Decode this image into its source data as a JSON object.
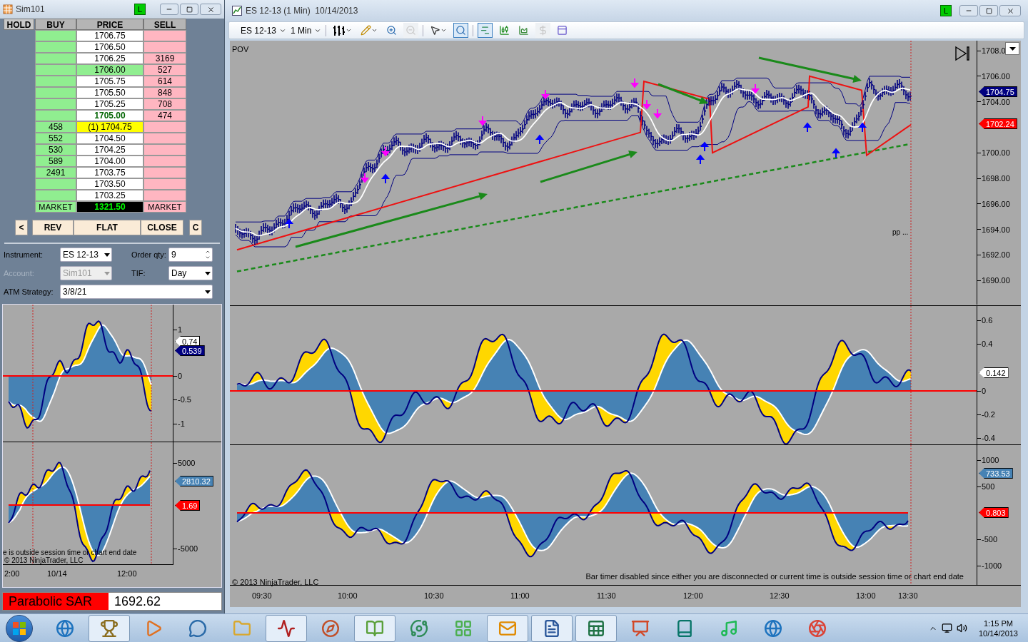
{
  "dom_window": {
    "title": "Sim101",
    "badge": "L",
    "columns": [
      "HOLD",
      "BUY",
      "PRICE",
      "SELL"
    ],
    "rows": [
      {
        "price": "1706.75",
        "kind": "plain"
      },
      {
        "price": "1706.50",
        "kind": "plain"
      },
      {
        "price": "1706.25",
        "sell": "3169",
        "kind": "plain"
      },
      {
        "price": "1706.00",
        "sell": "527",
        "kind": "inside"
      },
      {
        "price": "1705.75",
        "sell": "614",
        "kind": "plain"
      },
      {
        "price": "1705.50",
        "sell": "848",
        "kind": "plain"
      },
      {
        "price": "1705.25",
        "sell": "708",
        "kind": "plain"
      },
      {
        "price": "1705.00",
        "sell": "474",
        "kind": "last"
      },
      {
        "buy": "458",
        "price": "(1) 1704.75",
        "kind": "position"
      },
      {
        "buy": "552",
        "price": "1704.50",
        "kind": "plain"
      },
      {
        "buy": "530",
        "price": "1704.25",
        "kind": "plain"
      },
      {
        "buy": "589",
        "price": "1704.00",
        "kind": "plain"
      },
      {
        "buy": "2491",
        "price": "1703.75",
        "kind": "plain"
      },
      {
        "price": "1703.50",
        "kind": "plain"
      },
      {
        "price": "1703.25",
        "kind": "plain"
      },
      {
        "buy": "MARKET",
        "price": "1321.50",
        "sell": "MARKET",
        "kind": "market"
      }
    ],
    "buttons": [
      "<",
      "REV",
      "FLAT",
      "CLOSE",
      "C"
    ],
    "form": [
      {
        "label": "Instrument:",
        "value": "ES 12-13",
        "kind": "dropdown",
        "disabled": false
      },
      {
        "label": "Order qty:",
        "value": "9",
        "kind": "spinner",
        "disabled": false
      },
      {
        "label": "Account:",
        "value": "Sim101",
        "kind": "dropdown",
        "disabled": true
      },
      {
        "label": "TIF:",
        "value": "Day",
        "kind": "dropdown",
        "disabled": false
      },
      {
        "label": "ATM Strategy:",
        "value": "3/8/21",
        "kind": "dropdown",
        "disabled": false
      }
    ],
    "mini_chart": {
      "upper_axis": [
        "1",
        "0",
        "-0.5",
        "-1"
      ],
      "upper_markers": [
        {
          "text": "0.74",
          "color": "#ffffff"
        },
        {
          "text": "0.539",
          "color": "#000080"
        }
      ],
      "lower_axis": [
        "5000",
        "-5000"
      ],
      "lower_markers": [
        {
          "text": "2810.32",
          "color": "#4682b4"
        },
        {
          "text": "1.69",
          "color": "#ff0000"
        }
      ],
      "note": "e is outside session time or chart end date",
      "copyright": "© 2013 NinjaTrader, LLC",
      "time_labels": [
        "2:00",
        "10/14",
        "12:00"
      ]
    },
    "indicator": {
      "label": "Parabolic SAR",
      "value": "1692.62"
    }
  },
  "chart_window": {
    "title": "ES 12-13 (1 Min)  10/14/2013",
    "badge": "L",
    "instrument": "ES 12-13",
    "interval": "1 Min",
    "tool_buttons": [
      {
        "selected": false,
        "disabled": false
      },
      {
        "selected": false,
        "disabled": false
      },
      {
        "selected": false,
        "disabled": false
      },
      {
        "selected": false,
        "disabled": true
      },
      {
        "selected": false,
        "disabled": false
      },
      {
        "selected": true,
        "disabled": false
      },
      {
        "selected": true,
        "disabled": false
      },
      {
        "selected": false,
        "disabled": false
      },
      {
        "selected": false,
        "disabled": false
      },
      {
        "selected": false,
        "disabled": true
      },
      {
        "selected": false,
        "disabled": false
      }
    ],
    "price_panel": {
      "label": "POV",
      "pivot_label": "pp ...",
      "axis": [
        "1708.0",
        "1706.00",
        "1704.00",
        "1700.00",
        "1698.00",
        "1696.00",
        "1694.00",
        "1692.00",
        "1690.00"
      ],
      "markers": [
        {
          "text": "1704.75",
          "color": "#000080"
        },
        {
          "text": "1702.24",
          "color": "#ff0000"
        }
      ]
    },
    "oscillator_panel": {
      "axis": [
        "0.6",
        "0.4",
        "0",
        "-0.2",
        "-0.4"
      ],
      "markers": [
        {
          "text": "0.142",
          "color": "#ffffff"
        }
      ]
    },
    "volume_panel": {
      "axis": [
        "1000",
        "500",
        "-500",
        "-1000"
      ],
      "markers": [
        {
          "text": "733.53",
          "color": "#4682b4"
        },
        {
          "text": "0.803",
          "color": "#ff0000"
        }
      ]
    },
    "note": "Bar timer disabled since either you are disconnected or current time is outside session time or chart end date",
    "copyright": "© 2013 NinjaTrader, LLC",
    "time_labels": [
      "09:30",
      "10:00",
      "10:30",
      "11:00",
      "11:30",
      "12:00",
      "12:30",
      "13:00",
      "13:30"
    ]
  },
  "taskbar": {
    "apps": [
      {
        "running": false
      },
      {
        "running": true
      },
      {
        "running": false
      },
      {
        "running": false
      },
      {
        "running": false
      },
      {
        "running": true
      },
      {
        "running": false
      },
      {
        "running": true
      },
      {
        "running": false
      },
      {
        "running": false
      },
      {
        "running": true
      },
      {
        "running": true
      },
      {
        "running": true
      },
      {
        "running": false
      },
      {
        "running": false
      },
      {
        "running": false
      },
      {
        "running": false
      },
      {
        "running": false
      }
    ],
    "time": "1:15 PM",
    "date": "10/14/2013"
  }
}
